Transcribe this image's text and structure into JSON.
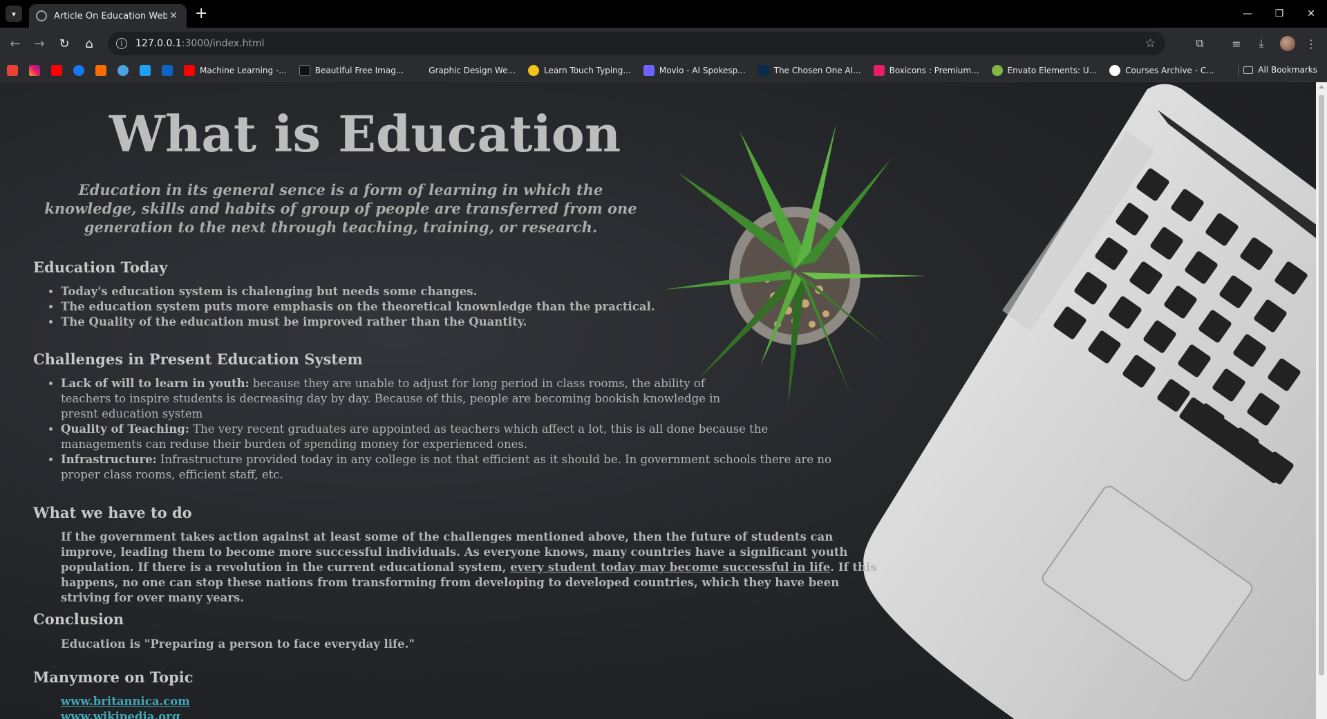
{
  "browser": {
    "tab_title": "Article On Education Website",
    "url_host": "127.0.0.1",
    "url_path": ":3000/index.html",
    "bookmarks": [
      {
        "label": "Machine Learning -...",
        "color": "#ff0000"
      },
      {
        "label": "Beautiful Free Imag...",
        "color": "#111111"
      },
      {
        "label": "Graphic Design We...",
        "color": "#2b2c2f"
      },
      {
        "label": "Learn Touch Typing...",
        "color": "#f0c419"
      },
      {
        "label": "Movio - AI Spokesp...",
        "color": "#6c63ff"
      },
      {
        "label": "The Chosen One AI...",
        "color": "#0b2b4a"
      },
      {
        "label": "Boxicons : Premium...",
        "color": "#e91e63"
      },
      {
        "label": "Envato Elements: U...",
        "color": "#82b541"
      },
      {
        "label": "Courses Archive - C...",
        "color": "#ffffff"
      }
    ],
    "all_bookmarks": "All Bookmarks"
  },
  "page": {
    "title": "What is Education",
    "lead": "Education in its general sence is a form of learning in which the knowledge, skills and habits of group of people are transferred from one generation to the next through teaching, training, or research.",
    "today": {
      "heading": "Education Today",
      "items": [
        "Today's education system is chalenging but needs some changes.",
        "The education system puts more emphasis on the theoretical knownledge than the practical.",
        "The Quality of the education must be improved rather than the Quantity."
      ]
    },
    "challenges": {
      "heading": "Challenges in Present Education System",
      "items": [
        {
          "term": "Lack of will to learn in youth:",
          "text": " because they are unable to adjust for long period in class rooms, the ability of teachers to inspire students is decreasing day by day. Because of this, people are becoming bookish knowledge in presnt education system"
        },
        {
          "term": "Quality of Teaching:",
          "text": " The very recent graduates are appointed as teachers which affect a lot, this is all done because the managements can reduse their burden of spending money for experienced ones."
        },
        {
          "term": "Infrastructure:",
          "text": " Infrastructure provided today in any college is not that efficient as it should be. In government schools there are no proper class rooms, efficient staff, etc."
        }
      ]
    },
    "todo": {
      "heading": "What we have to do",
      "text_before": "If the government takes action against at least some of the challenges mentioned above, then the future of students can improve, leading them to become more successful individuals. As everyone knows, many countries have a significant youth population. If there is a revolution in the current educational system, ",
      "link": "every student today may become successful in life",
      "text_after": ". If this happens, no one can stop these nations from transforming from developing to developed countries, which they have been striving for over many years."
    },
    "conclusion": {
      "heading": "Conclusion",
      "text": "Education is \"Preparing a person to face everyday life.\""
    },
    "more": {
      "heading": "Manymore on Topic",
      "links": [
        "www.britannica.com",
        "www.wikipedia.org"
      ]
    }
  }
}
